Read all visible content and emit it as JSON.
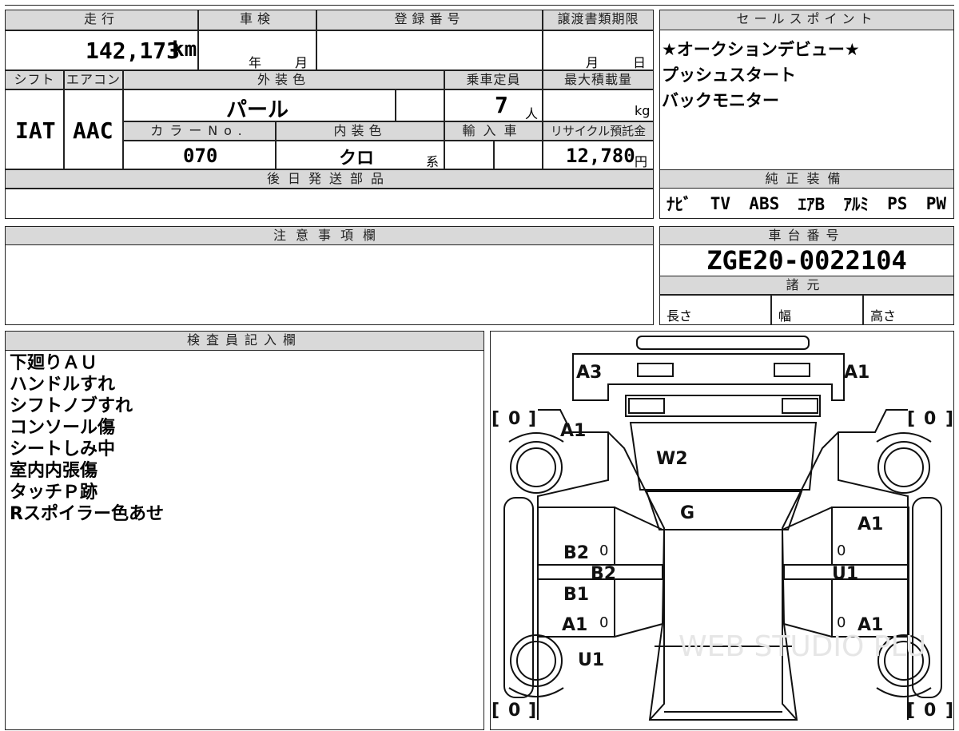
{
  "vehicle_info": {
    "mileage_label": "走行",
    "mileage_value": "142,173",
    "mileage_unit": "km",
    "shaken_label": "車検",
    "shaken_year": "年",
    "shaken_month": "月",
    "reg_label": "登録番号",
    "transfer_label": "譲渡書類期限",
    "transfer_month": "月",
    "transfer_day": "日",
    "shift_label": "シフト",
    "shift_value": "IAT",
    "ac_label": "エアコン",
    "ac_value": "AAC",
    "exterior_label": "外装色",
    "exterior_value": "パール",
    "capacity_label": "乗車定員",
    "capacity_value": "7",
    "capacity_unit": "人",
    "maxload_label": "最大積載量",
    "maxload_unit": "kg",
    "colorno_label": "カラーNo.",
    "colorno_value": "070",
    "interior_label": "内装色",
    "interior_value": "クロ",
    "interior_suffix": "系",
    "import_label": "輸入車",
    "recycle_label": "リサイクル預託金",
    "recycle_value": "12,780",
    "recycle_unit": "円",
    "later_parts_label": "後日発送部品"
  },
  "sales_points": {
    "header": "セールスポイント",
    "lines": [
      "★オークションデビュー★",
      "プッシュスタート",
      "バックモニター"
    ]
  },
  "equipment": {
    "header": "純正装備",
    "items": [
      "ﾅﾋﾞ",
      "TV",
      "ABS",
      "ｴｱB",
      "ｱﾙﾐ",
      "PS",
      "PW"
    ]
  },
  "notes_section": {
    "header": "注意事項欄"
  },
  "chassis": {
    "header": "車台番号",
    "number": "ZGE20-0022104",
    "spec_header": "諸元",
    "length_label": "長さ",
    "width_label": "幅",
    "height_label": "高さ"
  },
  "inspector": {
    "header": "検査員記入欄",
    "lines": [
      "下廻りＡＵ",
      "ハンドルすれ",
      "シフトノブすれ",
      "コンソール傷",
      "シートしみ中",
      "室内内張傷",
      "タッチＰ跡",
      "Rスポイラー色あせ"
    ]
  },
  "diagram": {
    "marks": {
      "rear_left": "A3",
      "rear_right": "A1",
      "quarter_left": "A1",
      "rear_glass": "W2",
      "roof": "G",
      "door_left_upper": "B2",
      "pillar_left": "B2",
      "door_left_lower": "B1",
      "rocker_left": "A1",
      "front_left": "U1",
      "door_right_upper": "A1",
      "pillar_right": "U1",
      "rocker_right": "A1"
    },
    "tire_value": "0",
    "tire_bracket_open": "[",
    "tire_bracket_close": "]",
    "watermark": "WEB STUDIO PLU"
  }
}
